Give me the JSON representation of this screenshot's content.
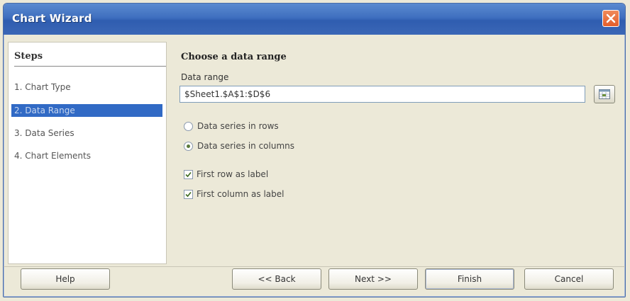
{
  "window": {
    "title": "Chart Wizard"
  },
  "steps": {
    "heading": "Steps",
    "items": [
      {
        "label": "1. Chart Type"
      },
      {
        "label": "2. Data Range"
      },
      {
        "label": "3. Data Series"
      },
      {
        "label": "4. Chart Elements"
      }
    ],
    "active_index": 1
  },
  "main": {
    "title": "Choose a data range",
    "data_range_label": "Data range",
    "data_range_value": "$Sheet1.$A$1:$D$6",
    "options": {
      "rows_label": "Data series in rows",
      "columns_label": "Data series in columns",
      "selected": "columns",
      "first_row_label": "First row as label",
      "first_row_checked": true,
      "first_column_label": "First column as label",
      "first_column_checked": true
    }
  },
  "footer": {
    "help": "Help",
    "back": "<< Back",
    "next": "Next >>",
    "finish": "Finish",
    "cancel": "Cancel"
  },
  "colors": {
    "titlebar": "#3f6fbf",
    "selection": "#316ac5",
    "close": "#e35e2c"
  },
  "icons": {
    "close": "close-icon",
    "range_picker": "range-picker-icon",
    "checkmark": "checkmark-icon"
  }
}
